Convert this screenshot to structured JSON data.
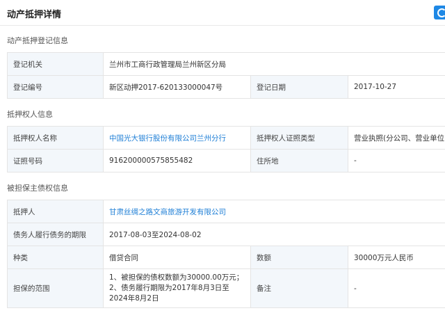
{
  "header": {
    "title": "动产抵押详情"
  },
  "registration": {
    "section_title": "动产抵押登记信息",
    "authority_label": "登记机关",
    "authority_value": "兰州市工商行政管理局兰州新区分局",
    "number_label": "登记编号",
    "number_value": "新区动押2017-620133000047号",
    "date_label": "登记日期",
    "date_value": "2017-10-27"
  },
  "mortgagee": {
    "section_title": "抵押权人信息",
    "name_label": "抵押权人名称",
    "name_value": "中国光大银行股份有限公司兰州分行",
    "cert_type_label": "抵押权人证照类型",
    "cert_type_value": "营业执照(分公司、营业单位)",
    "cert_no_label": "证照号码",
    "cert_no_value": "916200000575855482",
    "address_label": "住所地",
    "address_value": "-"
  },
  "secured_claim": {
    "section_title": "被担保主债权信息",
    "mortgagor_label": "抵押人",
    "mortgagor_value": "甘肃丝绸之路文商旅游开发有限公司",
    "period_label": "债务人履行债务的期限",
    "period_value": "2017-08-03至2024-08-02",
    "type_label": "种类",
    "type_value": "借贷合同",
    "amount_label": "数额",
    "amount_value": "30000万元人民币",
    "scope_label": "担保的范围",
    "scope_value": "1、被担保的债权数额为30000.00万元； 2、债务履行期限为2017年8月3日至2024年8月2日",
    "remark_label": "备注",
    "remark_value": "-"
  }
}
